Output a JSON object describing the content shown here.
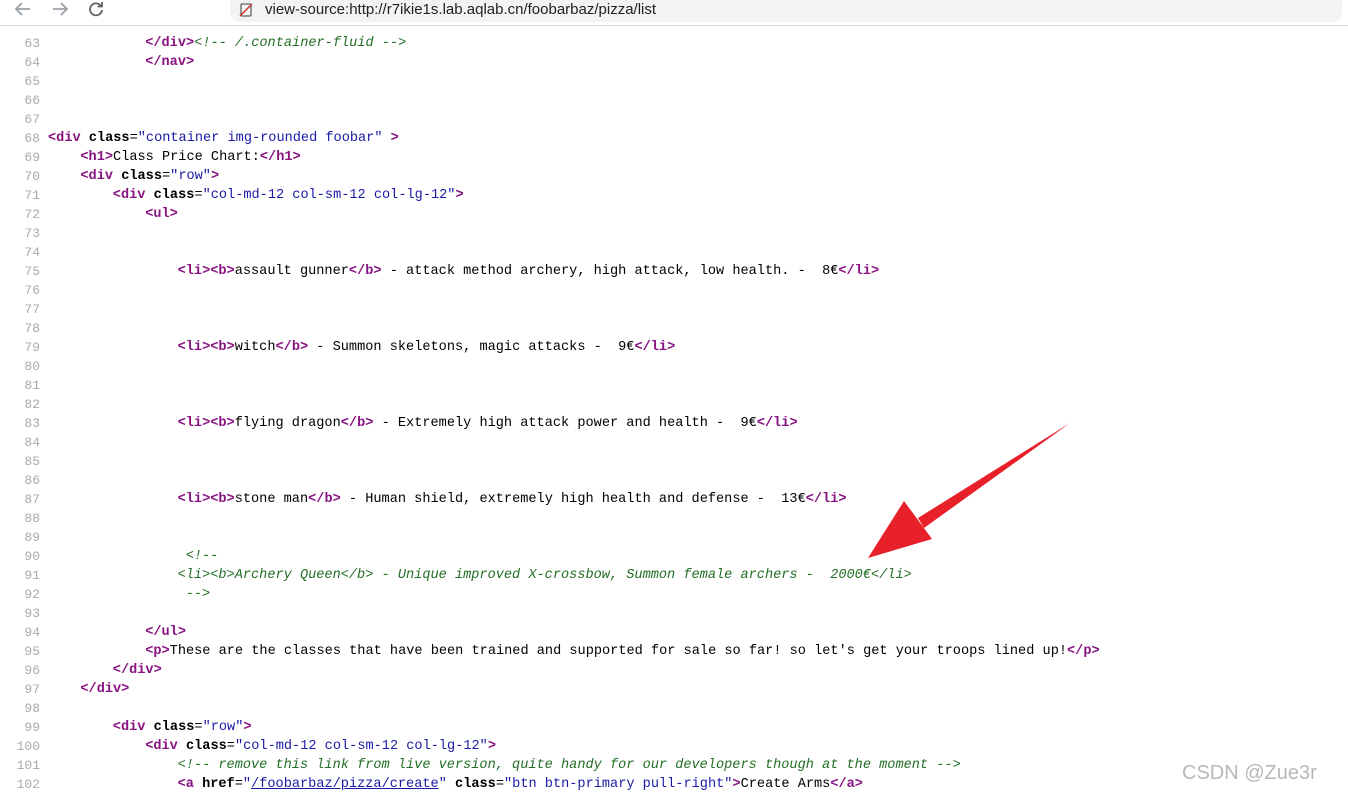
{
  "browser": {
    "url": "view-source:http://r7ikie1s.lab.aqlab.cn/foobarbaz/pizza/list",
    "back_icon": "arrow-left-icon",
    "forward_icon": "arrow-right-icon",
    "reload_icon": "reload-icon",
    "site_icon": "page-warning-icon"
  },
  "source": {
    "lines": [
      {
        "num": "63",
        "indent": 12,
        "segs": [
          [
            "tg",
            "</div>"
          ],
          [
            "cm",
            "<!-- /.container-fluid -->"
          ]
        ]
      },
      {
        "num": "64",
        "indent": 12,
        "segs": [
          [
            "tg",
            "</nav>"
          ]
        ]
      },
      {
        "num": "65",
        "indent": 0,
        "segs": []
      },
      {
        "num": "66",
        "indent": 0,
        "segs": []
      },
      {
        "num": "67",
        "indent": 0,
        "segs": []
      },
      {
        "num": "68",
        "indent": 0,
        "segs": [
          [
            "tg",
            "<div "
          ],
          [
            "at",
            "class"
          ],
          [
            "tx",
            "="
          ],
          [
            "av",
            "\"container img-rounded foobar\""
          ],
          [
            "tx",
            " "
          ],
          [
            "tg",
            ">"
          ]
        ]
      },
      {
        "num": "69",
        "indent": 4,
        "segs": [
          [
            "tg",
            "<h1>"
          ],
          [
            "tx",
            "Class Price Chart:"
          ],
          [
            "tg",
            "</h1>"
          ]
        ]
      },
      {
        "num": "70",
        "indent": 4,
        "segs": [
          [
            "tg",
            "<div "
          ],
          [
            "at",
            "class"
          ],
          [
            "tx",
            "="
          ],
          [
            "av",
            "\"row\""
          ],
          [
            "tg",
            ">"
          ]
        ]
      },
      {
        "num": "71",
        "indent": 8,
        "segs": [
          [
            "tg",
            "<div "
          ],
          [
            "at",
            "class"
          ],
          [
            "tx",
            "="
          ],
          [
            "av",
            "\"col-md-12 col-sm-12 col-lg-12\""
          ],
          [
            "tg",
            ">"
          ]
        ]
      },
      {
        "num": "72",
        "indent": 12,
        "segs": [
          [
            "tg",
            "<ul>"
          ]
        ]
      },
      {
        "num": "73",
        "indent": 0,
        "segs": []
      },
      {
        "num": "74",
        "indent": 0,
        "segs": []
      },
      {
        "num": "75",
        "indent": 16,
        "segs": [
          [
            "tg",
            "<li><b>"
          ],
          [
            "tx",
            "assault gunner"
          ],
          [
            "tg",
            "</b>"
          ],
          [
            "tx",
            " - attack method archery, high attack, low health. -  8€"
          ],
          [
            "tg",
            "</li>"
          ]
        ]
      },
      {
        "num": "76",
        "indent": 0,
        "segs": []
      },
      {
        "num": "77",
        "indent": 0,
        "segs": []
      },
      {
        "num": "78",
        "indent": 0,
        "segs": []
      },
      {
        "num": "79",
        "indent": 16,
        "segs": [
          [
            "tg",
            "<li><b>"
          ],
          [
            "tx",
            "witch"
          ],
          [
            "tg",
            "</b>"
          ],
          [
            "tx",
            " - Summon skeletons, magic attacks -  9€"
          ],
          [
            "tg",
            "</li>"
          ]
        ]
      },
      {
        "num": "80",
        "indent": 0,
        "segs": []
      },
      {
        "num": "81",
        "indent": 0,
        "segs": []
      },
      {
        "num": "82",
        "indent": 0,
        "segs": []
      },
      {
        "num": "83",
        "indent": 16,
        "segs": [
          [
            "tg",
            "<li><b>"
          ],
          [
            "tx",
            "flying dragon"
          ],
          [
            "tg",
            "</b>"
          ],
          [
            "tx",
            " - Extremely high attack power and health -  9€"
          ],
          [
            "tg",
            "</li>"
          ]
        ]
      },
      {
        "num": "84",
        "indent": 0,
        "segs": []
      },
      {
        "num": "85",
        "indent": 0,
        "segs": []
      },
      {
        "num": "86",
        "indent": 0,
        "segs": []
      },
      {
        "num": "87",
        "indent": 16,
        "segs": [
          [
            "tg",
            "<li><b>"
          ],
          [
            "tx",
            "stone man"
          ],
          [
            "tg",
            "</b>"
          ],
          [
            "tx",
            " - Human shield, extremely high health and defense -  13€"
          ],
          [
            "tg",
            "</li>"
          ]
        ]
      },
      {
        "num": "88",
        "indent": 0,
        "segs": []
      },
      {
        "num": "89",
        "indent": 0,
        "segs": []
      },
      {
        "num": "90",
        "indent": 17,
        "segs": [
          [
            "cm",
            "<!--"
          ]
        ]
      },
      {
        "num": "91",
        "indent": 16,
        "segs": [
          [
            "cm",
            "<li><b>Archery Queen</b> - Unique improved X-crossbow, Summon female archers -  2000€</li>"
          ]
        ]
      },
      {
        "num": "92",
        "indent": 17,
        "segs": [
          [
            "cm",
            "-->"
          ]
        ]
      },
      {
        "num": "93",
        "indent": 0,
        "segs": []
      },
      {
        "num": "94",
        "indent": 12,
        "segs": [
          [
            "tg",
            "</ul>"
          ]
        ]
      },
      {
        "num": "95",
        "indent": 12,
        "segs": [
          [
            "tg",
            "<p>"
          ],
          [
            "tx",
            "These are the classes that have been trained and supported for sale so far! so let's get your troops lined up!"
          ],
          [
            "tg",
            "</p>"
          ]
        ]
      },
      {
        "num": "96",
        "indent": 8,
        "segs": [
          [
            "tg",
            "</div>"
          ]
        ]
      },
      {
        "num": "97",
        "indent": 4,
        "segs": [
          [
            "tg",
            "</div>"
          ]
        ]
      },
      {
        "num": "98",
        "indent": 0,
        "segs": []
      },
      {
        "num": "99",
        "indent": 8,
        "segs": [
          [
            "tg",
            "<div "
          ],
          [
            "at",
            "class"
          ],
          [
            "tx",
            "="
          ],
          [
            "av",
            "\"row\""
          ],
          [
            "tg",
            ">"
          ]
        ]
      },
      {
        "num": "100",
        "indent": 12,
        "segs": [
          [
            "tg",
            "<div "
          ],
          [
            "at",
            "class"
          ],
          [
            "tx",
            "="
          ],
          [
            "av",
            "\"col-md-12 col-sm-12 col-lg-12\""
          ],
          [
            "tg",
            ">"
          ]
        ]
      },
      {
        "num": "101",
        "indent": 16,
        "segs": [
          [
            "cm",
            "<!-- remove this link from live version, quite handy for our developers though at the moment -->"
          ]
        ]
      },
      {
        "num": "102",
        "indent": 16,
        "segs": [
          [
            "tg",
            "<a "
          ],
          [
            "at",
            "href"
          ],
          [
            "tx",
            "="
          ],
          [
            "av",
            "\""
          ],
          [
            "lk",
            "/foobarbaz/pizza/create"
          ],
          [
            "av",
            "\""
          ],
          [
            "tx",
            " "
          ],
          [
            "at",
            "class"
          ],
          [
            "tx",
            "="
          ],
          [
            "av",
            "\"btn btn-primary pull-right\""
          ],
          [
            "tg",
            ">"
          ],
          [
            "tx",
            "Create Arms"
          ],
          [
            "tg",
            "</a>"
          ]
        ]
      }
    ]
  },
  "annotation": {
    "arrow_color": "#e8202a"
  },
  "watermark": "CSDN @Zue3r"
}
